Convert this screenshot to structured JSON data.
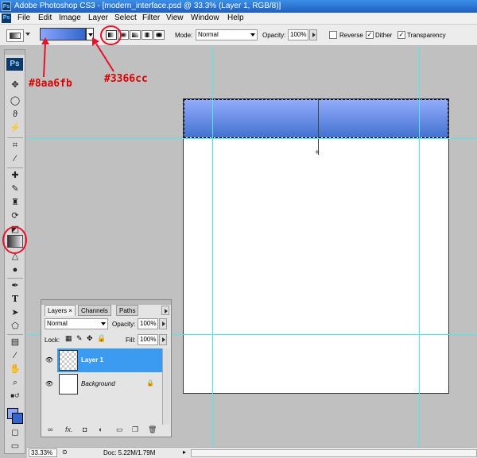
{
  "window": {
    "title": "Adobe Photoshop CS3 - [modern_interface.psd @ 33.3% (Layer 1, RGB/8)]",
    "app_icon": "Ps"
  },
  "menu": [
    "File",
    "Edit",
    "Image",
    "Layer",
    "Select",
    "Filter",
    "View",
    "Window",
    "Help"
  ],
  "options": {
    "mode_label": "Mode:",
    "mode_value": "Normal",
    "opacity_label": "Opacity:",
    "opacity_value": "100%",
    "reverse_label": "Reverse",
    "dither_label": "Dither",
    "transparency_label": "Transparency",
    "reverse_checked": false,
    "dither_checked": true,
    "transparency_checked": true,
    "gradient_colors": [
      "#8aa6fb",
      "#3366cc"
    ]
  },
  "annotations": {
    "start_color": "#8aa6fb",
    "end_color": "#3366cc"
  },
  "tools": {
    "logo": "Ps"
  },
  "layers_panel": {
    "tabs": [
      "Layers",
      "Channels",
      "Paths"
    ],
    "blend_mode": "Normal",
    "opacity_label": "Opacity:",
    "opacity_value": "100%",
    "lock_label": "Lock:",
    "fill_label": "Fill:",
    "fill_value": "100%",
    "layers": [
      {
        "name": "Layer 1",
        "selected": true
      },
      {
        "name": "Background",
        "selected": false
      }
    ]
  },
  "status": {
    "zoom": "33.33%",
    "doc": "Doc: 5.22M/1.79M"
  },
  "colors": {
    "foreground": "#8aa6fb",
    "background": "#3366cc",
    "guide": "#4ee8f0"
  }
}
